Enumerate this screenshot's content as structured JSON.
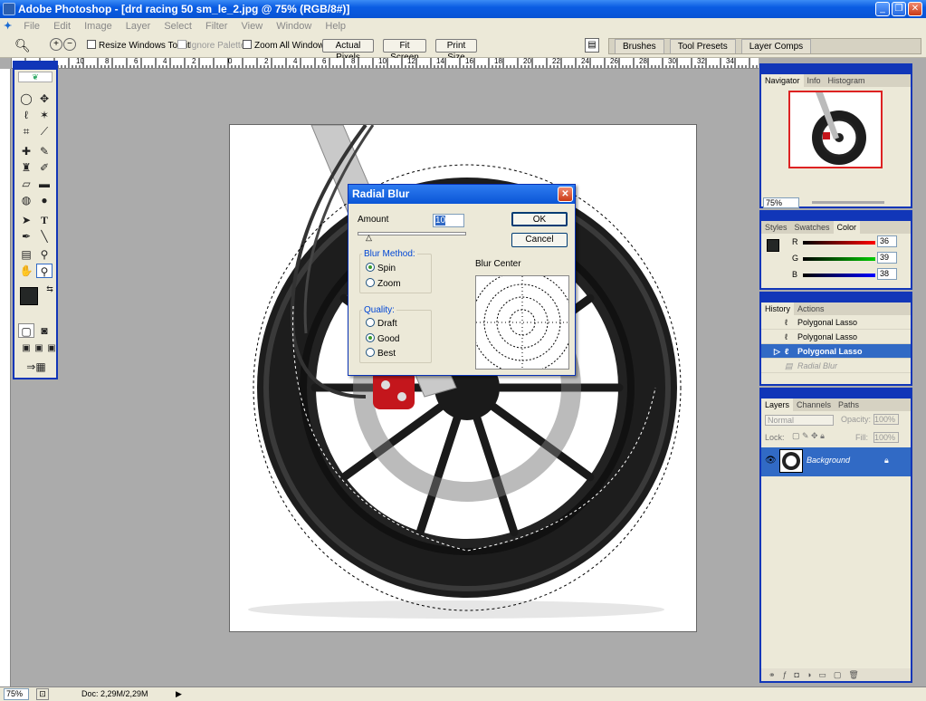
{
  "window": {
    "title": "Adobe Photoshop - [drd racing 50 sm_le_2.jpg @ 75% (RGB/8#)]"
  },
  "menu": [
    "File",
    "Edit",
    "Image",
    "Layer",
    "Select",
    "Filter",
    "View",
    "Window",
    "Help"
  ],
  "options": {
    "resize_windows": "Resize Windows To Fit",
    "ignore_palettes": "Ignore Palettes",
    "zoom_all": "Zoom All Windows",
    "actual_pixels": "Actual Pixels",
    "fit_screen": "Fit Screen",
    "print_size": "Print Size"
  },
  "palette_well": [
    "Brushes",
    "Tool Presets",
    "Layer Comps"
  ],
  "ruler_marks": [
    "10",
    "8",
    "6",
    "4",
    "2",
    "0",
    "2",
    "4",
    "6",
    "8",
    "10",
    "12",
    "14",
    "16",
    "18",
    "20",
    "22",
    "24",
    "26",
    "28",
    "30",
    "32",
    "34",
    "36",
    "38",
    "40"
  ],
  "dialog": {
    "title": "Radial Blur",
    "amount_label": "Amount",
    "amount_value": "10",
    "ok": "OK",
    "cancel": "Cancel",
    "blur_method_label": "Blur Method:",
    "spin": "Spin",
    "zoom": "Zoom",
    "quality_label": "Quality:",
    "draft": "Draft",
    "good": "Good",
    "best": "Best",
    "blur_center_label": "Blur Center"
  },
  "navigator": {
    "tabs": [
      "Navigator",
      "Info",
      "Histogram"
    ],
    "zoom": "75%"
  },
  "color_panel": {
    "tabs": [
      "Styles",
      "Swatches",
      "Color"
    ],
    "r": "36",
    "g": "39",
    "b": "38",
    "r_label": "R",
    "g_label": "G",
    "b_label": "B",
    "foreground": "#242726"
  },
  "history_panel": {
    "tabs": [
      "History",
      "Actions"
    ],
    "items": [
      "Polygonal Lasso",
      "Polygonal Lasso",
      "Polygonal Lasso",
      "Radial Blur"
    ]
  },
  "layers_panel": {
    "tabs": [
      "Layers",
      "Channels",
      "Paths"
    ],
    "blend_mode": "Normal",
    "opacity_label": "Opacity:",
    "opacity": "100%",
    "lock_label": "Lock:",
    "fill_label": "Fill:",
    "fill": "100%",
    "layer_name": "Background"
  },
  "status": {
    "zoom": "75%",
    "doc": "Doc: 2,29M/2,29M"
  },
  "colors": {
    "xp_blue": "#1136b8",
    "selection_blue": "#316ac5"
  }
}
